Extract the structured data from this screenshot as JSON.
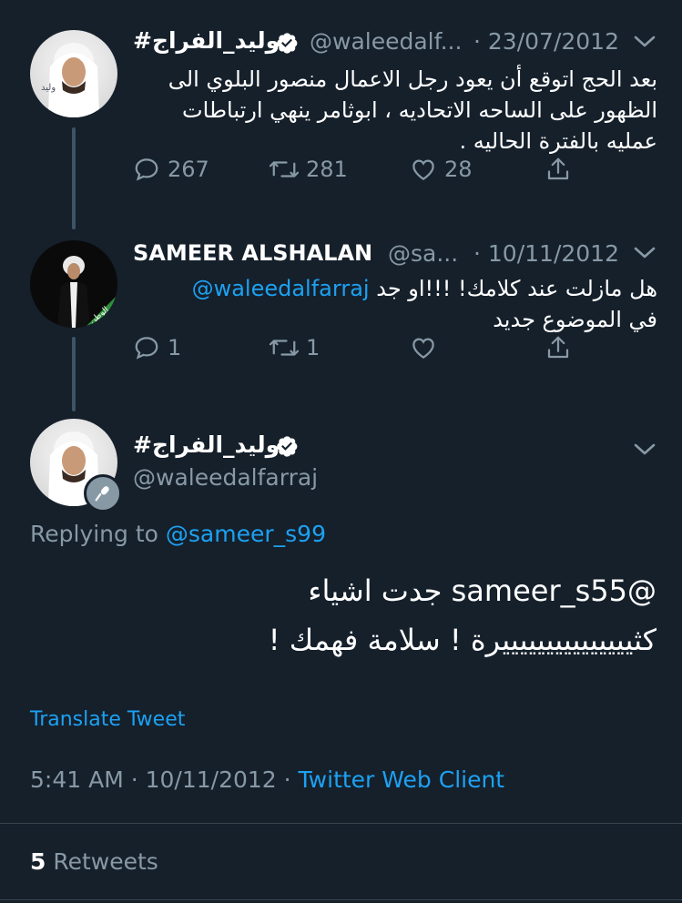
{
  "colors": {
    "bg": "#15202b",
    "text": "#ffffff",
    "muted": "#8899a6",
    "accent": "#1da1f2",
    "verified": "#ffffff"
  },
  "tweet1": {
    "name": "#وليد_الفراج",
    "handle": "@waleedalf...",
    "date": "· 23/07/2012",
    "text": "بعد الحج اتوقع أن يعود رجل الاعمال منصور البلوي الى الظهور على الساحه الاتحاديه ، ابوثامر ينهي ارتباطات عمليه بالفترة الحاليه .",
    "replies": "267",
    "retweets": "281",
    "likes": "28"
  },
  "tweet2": {
    "name": "SAMEER ALSHALAN",
    "handle": "@sa...",
    "date": "· 10/11/2012",
    "mention": "@waleedalfarraj",
    "text_line1": "هل مازلت عند كلامك! !!!او جد",
    "text_line2": "في الموضوع جديد",
    "replies": "1",
    "retweets": "1"
  },
  "main_tweet": {
    "name": "#وليد_الفراج",
    "handle": "@waleedalfarraj",
    "replying_prefix": "Replying to",
    "replying_to": "@sameer_s99",
    "text_line1": "@sameer_s55 جدت اشياء",
    "text_line2": "كثيييييييييييييييرة ! سلامة فهمك !",
    "translate": "Translate Tweet",
    "time": "5:41 AM · 10/11/2012 ·",
    "client": "Twitter Web Client",
    "retweet_count": "5",
    "retweet_label": "Retweets"
  },
  "icons": [
    "reply-icon",
    "retweet-icon",
    "like-icon",
    "share-icon",
    "chevron-down-icon",
    "verified-badge-icon",
    "microphone-icon"
  ]
}
